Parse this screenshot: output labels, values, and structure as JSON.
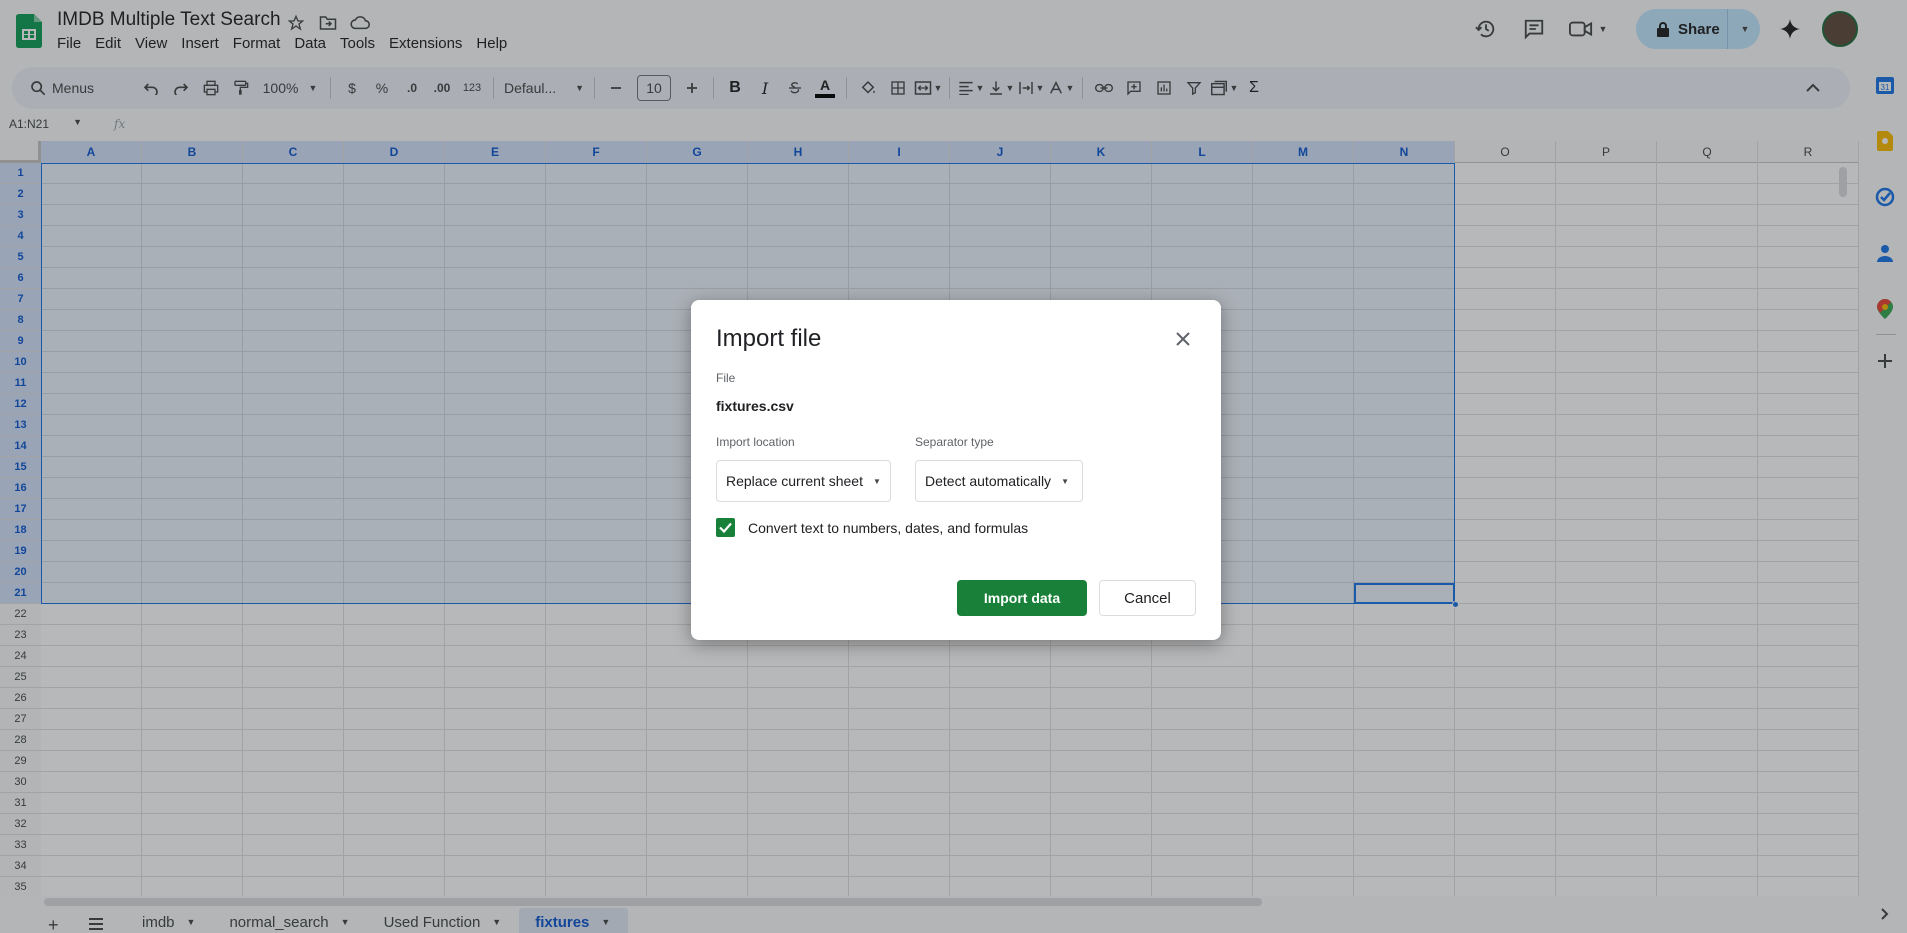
{
  "document": {
    "title": "IMDB Multiple Text Search"
  },
  "menus": [
    "File",
    "Edit",
    "View",
    "Insert",
    "Format",
    "Data",
    "Tools",
    "Extensions",
    "Help"
  ],
  "header": {
    "share_label": "Share"
  },
  "toolbar": {
    "search_label": "Menus",
    "zoom": "100%",
    "currency": "$",
    "percent": "%",
    "decrease_decimal": ".0",
    "increase_decimal": ".00",
    "number_format": "123",
    "font": "Defaul...",
    "font_size": "10",
    "bold": "B",
    "italic": "I",
    "text_color_glyph": "A",
    "sigma": "Σ"
  },
  "formula_bar": {
    "name_box": "A1:N21",
    "fx": "fx"
  },
  "grid": {
    "columns": [
      "A",
      "B",
      "C",
      "D",
      "E",
      "F",
      "G",
      "H",
      "I",
      "J",
      "K",
      "L",
      "M",
      "N",
      "O",
      "P",
      "Q",
      "R"
    ],
    "rows": [
      "1",
      "2",
      "3",
      "4",
      "5",
      "6",
      "7",
      "8",
      "9",
      "10",
      "11",
      "12",
      "13",
      "14",
      "15",
      "16",
      "17",
      "18",
      "19",
      "20",
      "21",
      "22",
      "23",
      "24",
      "25",
      "26",
      "27",
      "28",
      "29",
      "30",
      "31",
      "32",
      "33",
      "34",
      "35"
    ],
    "selected_range": "A1:N21"
  },
  "sheets": {
    "tabs": [
      {
        "label": "imdb",
        "active": false
      },
      {
        "label": "normal_search",
        "active": false
      },
      {
        "label": "Used Function",
        "active": false
      },
      {
        "label": "fixtures",
        "active": true
      }
    ]
  },
  "dialog": {
    "title": "Import file",
    "file_label": "File",
    "file_name": "fixtures.csv",
    "import_location_label": "Import location",
    "import_location_value": "Replace current sheet",
    "separator_label": "Separator type",
    "separator_value": "Detect automatically",
    "convert_label": "Convert text to numbers, dates, and formulas",
    "convert_checked": true,
    "import_button": "Import data",
    "cancel_button": "Cancel"
  },
  "colors": {
    "accent_green": "#188038",
    "selection_blue": "#1a73e8",
    "share_bg": "#c2e7ff"
  }
}
